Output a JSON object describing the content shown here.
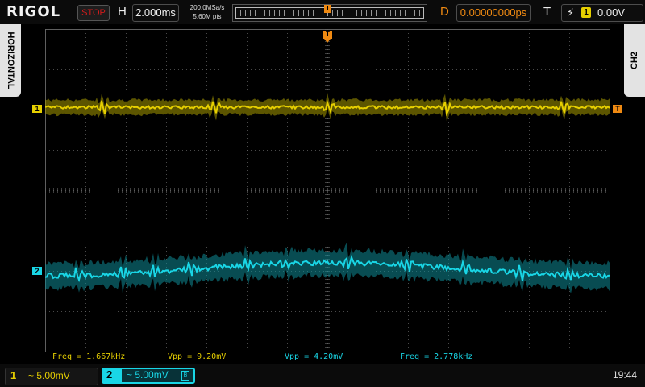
{
  "header": {
    "logo": "RIGOL",
    "run_state": "STOP",
    "horizontal_label": "H",
    "timebase": "2.000ms",
    "sample_rate": "200.0MSa/s",
    "memory_depth": "5.60M pts",
    "memory_trigger_marker": "T",
    "delay_label": "D",
    "delay_value": "0.00000000ps",
    "trigger_label": "T",
    "trigger_source": "1",
    "trigger_level": "0.00V"
  },
  "side_tabs": {
    "left": "HORIZONTAL",
    "right": "CH2"
  },
  "markers": {
    "ch1": "1",
    "ch2": "2",
    "trigger_level": "T",
    "trigger_position": "T"
  },
  "measurements": {
    "ch1_freq": "Freq = 1.667kHz",
    "ch1_vpp": "Vpp = 9.20mV",
    "ch2_vpp": "Vpp = 4.20mV",
    "ch2_freq": "Freq = 2.778kHz"
  },
  "footer": {
    "ch1_number": "1",
    "ch1_scale": "~ 5.00mV",
    "ch2_number": "2",
    "ch2_scale": "~ 5.00mV",
    "ch2_bw_icon": "B",
    "clock": "19:44"
  },
  "colors": {
    "ch1": "#e6cf00",
    "ch2": "#19d6e6",
    "trigger": "#f08a12",
    "run_state": "#d41b1b"
  },
  "icons": [
    "rising-edge-icon",
    "bandwidth-limit-icon"
  ]
}
